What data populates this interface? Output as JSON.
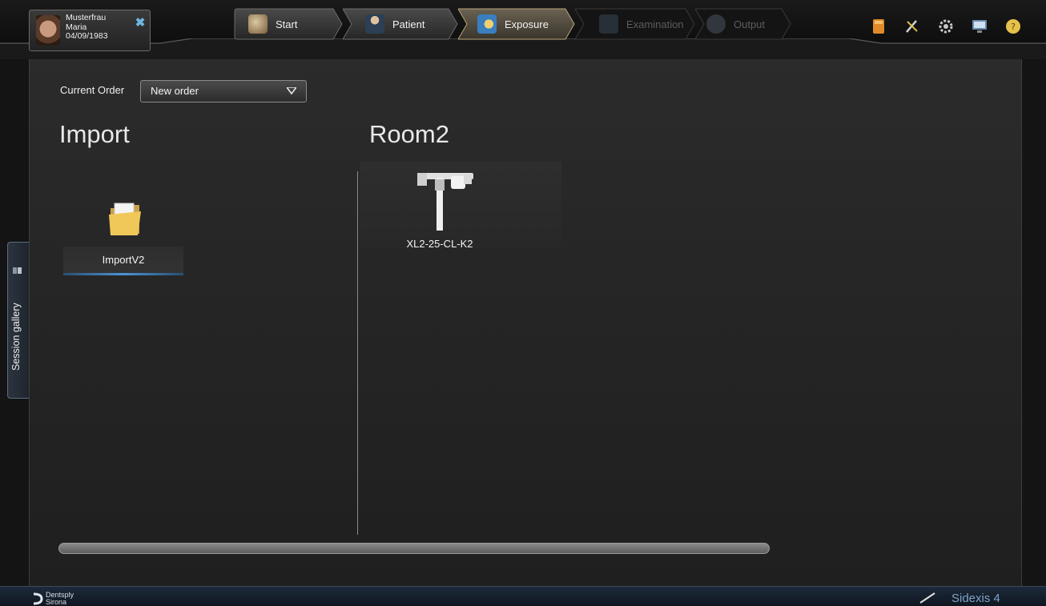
{
  "patient": {
    "last_name": "Musterfrau",
    "first_name": "Maria",
    "birthdate": "04/09/1983"
  },
  "workflow_steps": [
    {
      "label": "Start",
      "icon": "house-icon",
      "state": "done"
    },
    {
      "label": "Patient",
      "icon": "person-icon",
      "state": "done"
    },
    {
      "label": "Exposure",
      "icon": "exposure-icon",
      "state": "active"
    },
    {
      "label": "Examination",
      "icon": "examination-icon",
      "state": "disabled"
    },
    {
      "label": "Output",
      "icon": "output-icon",
      "state": "disabled"
    }
  ],
  "toolbar_icons": [
    "book-icon",
    "tools-icon",
    "settings-gear-icon",
    "monitor-icon",
    "help-icon"
  ],
  "order": {
    "label": "Current Order",
    "selected": "New order"
  },
  "import": {
    "title": "Import",
    "devices": [
      {
        "name": "ImportV2",
        "icon": "folder-icon"
      }
    ]
  },
  "room": {
    "title": "Room2",
    "devices": [
      {
        "name": "XL2-25-CL-K2",
        "icon": "xray-device-icon"
      }
    ]
  },
  "scroll": {
    "visible_fraction": 0.75
  },
  "side_tab": {
    "label": "Session gallery"
  },
  "footer": {
    "brand_line1": "Dentsply",
    "brand_line2": "Sirona",
    "product": "Sidexis 4"
  },
  "colors": {
    "accent_blue": "#4b93d6",
    "active_step": "#b9a47a"
  }
}
